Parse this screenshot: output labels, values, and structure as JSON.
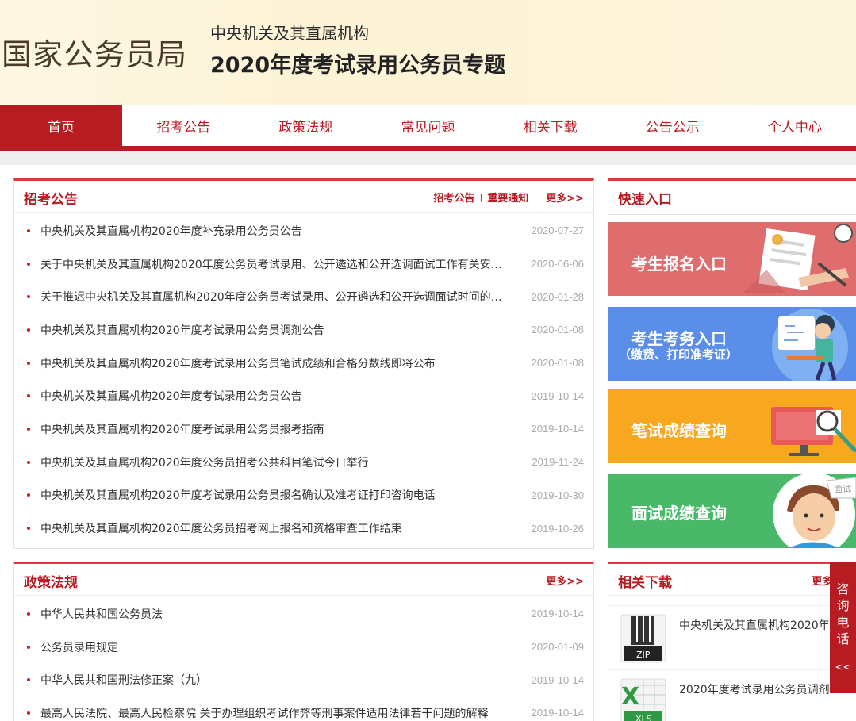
{
  "header": {
    "logo": "国家公务员局",
    "subtitle": "中央机关及其直属机构",
    "title": "2020年度考试录用公务员专题"
  },
  "nav": [
    {
      "label": "首页",
      "active": true
    },
    {
      "label": "招考公告"
    },
    {
      "label": "政策法规"
    },
    {
      "label": "常见问题"
    },
    {
      "label": "相关下载"
    },
    {
      "label": "公告公示"
    },
    {
      "label": "个人中心"
    }
  ],
  "recruit": {
    "title": "招考公告",
    "link1": "招考公告",
    "sep": "|",
    "link2": "重要通知",
    "more": "更多>>",
    "items": [
      {
        "title": "中央机关及其直属机构2020年度补充录用公务员公告",
        "date": "2020-07-27"
      },
      {
        "title": "关于中央机关及其直属机构2020年度公务员考试录用、公开遴选和公开选调面试工作有关安…",
        "date": "2020-06-06"
      },
      {
        "title": "关于推迟中央机关及其直属机构2020年度公务员考试录用、公开遴选和公开选调面试时间的…",
        "date": "2020-01-28"
      },
      {
        "title": "中央机关及其直属机构2020年度考试录用公务员调剂公告",
        "date": "2020-01-08"
      },
      {
        "title": "中央机关及其直属机构2020年度考试录用公务员笔试成绩和合格分数线即将公布",
        "date": "2020-01-08"
      },
      {
        "title": "中央机关及其直属机构2020年度考试录用公务员公告",
        "date": "2019-10-14"
      },
      {
        "title": "中央机关及其直属机构2020年度考试录用公务员报考指南",
        "date": "2019-10-14"
      },
      {
        "title": "中央机关及其直属机构2020年度公务员招考公共科目笔试今日举行",
        "date": "2019-11-24"
      },
      {
        "title": "中央机关及其直属机构2020年度考试录用公务员报名确认及准考证打印咨询电话",
        "date": "2019-10-30"
      },
      {
        "title": "中央机关及其直属机构2020年度公务员招考网上报名和资格审查工作结束",
        "date": "2019-10-26"
      }
    ]
  },
  "policy": {
    "title": "政策法规",
    "more": "更多>>",
    "items": [
      {
        "title": "中华人民共和国公务员法",
        "date": "2019-10-14"
      },
      {
        "title": "公务员录用规定",
        "date": "2020-01-09"
      },
      {
        "title": "中华人民共和国刑法修正案（九）",
        "date": "2019-10-14"
      },
      {
        "title": "最高人民法院、最高人民检察院 关于办理组织考试作弊等刑事案件适用法律若干问题的解释",
        "date": "2019-10-14"
      }
    ]
  },
  "quick": {
    "title": "快速入口",
    "entries": [
      {
        "label": "考生报名入口",
        "color": "#e06d6d"
      },
      {
        "label": "考生考务入口",
        "sub": "（缴费、打印准考证）",
        "color": "#5b8ee8"
      },
      {
        "label": "笔试成绩查询",
        "color": "#f7a81f"
      },
      {
        "label": "面试成绩查询",
        "color": "#4ab869"
      }
    ]
  },
  "downloads": {
    "title": "相关下载",
    "more": "更多>>",
    "items": [
      {
        "text": "中央机关及其直属机构2020年",
        "badge": "ZIP"
      },
      {
        "text": "2020年度考试录用公务员调剂",
        "badge": "XLS",
        "mark": "X"
      }
    ]
  },
  "consult": {
    "chars": [
      "咨",
      "询",
      "电",
      "话"
    ],
    "arrow": "<<"
  },
  "colors": {
    "brand": "#b81c22",
    "panel_border_top": "#d83c3c"
  }
}
